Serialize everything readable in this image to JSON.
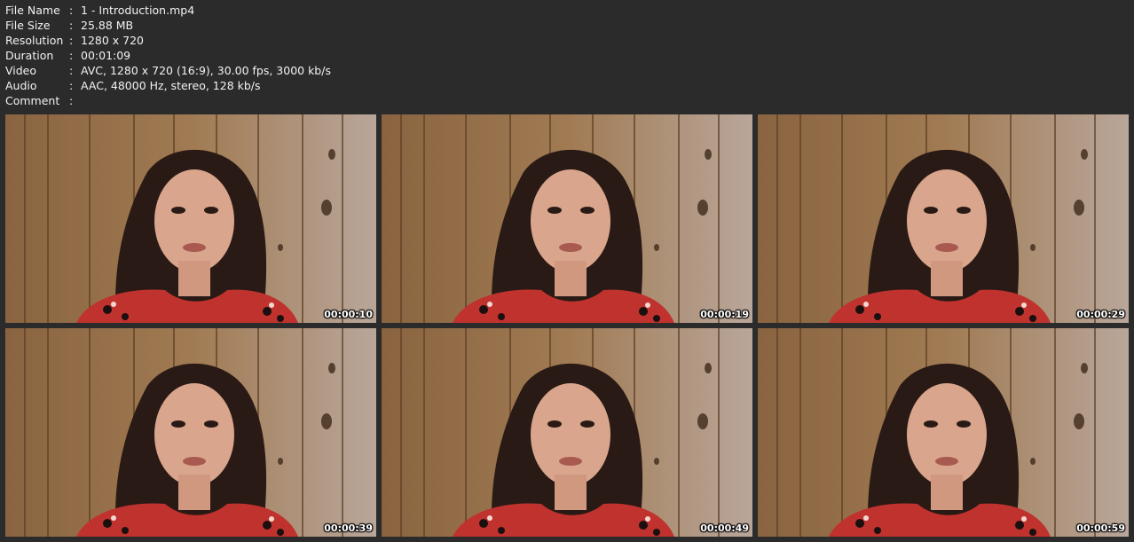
{
  "info": [
    {
      "label": "File Name",
      "value": "1 - Introduction.mp4"
    },
    {
      "label": "File Size",
      "value": "25.88 MB"
    },
    {
      "label": "Resolution",
      "value": "1280 x 720"
    },
    {
      "label": "Duration",
      "value": "00:01:09"
    },
    {
      "label": "Video",
      "value": "AVC, 1280 x 720 (16:9), 30.00 fps, 3000 kb/s"
    },
    {
      "label": "Audio",
      "value": "AAC, 48000 Hz, stereo, 128 kb/s"
    },
    {
      "label": "Comment",
      "value": ""
    }
  ],
  "separator": ":",
  "thumbnails": [
    {
      "timestamp": "00:00:10"
    },
    {
      "timestamp": "00:00:19"
    },
    {
      "timestamp": "00:00:29"
    },
    {
      "timestamp": "00:00:39"
    },
    {
      "timestamp": "00:00:49"
    },
    {
      "timestamp": "00:00:59"
    }
  ],
  "colors": {
    "background": "#2b2b2b",
    "text": "#f2f2f2",
    "wood": "#9a7550",
    "hair": "#2a1a16",
    "skin": "#d9a58c",
    "dress": "#c0322e"
  }
}
